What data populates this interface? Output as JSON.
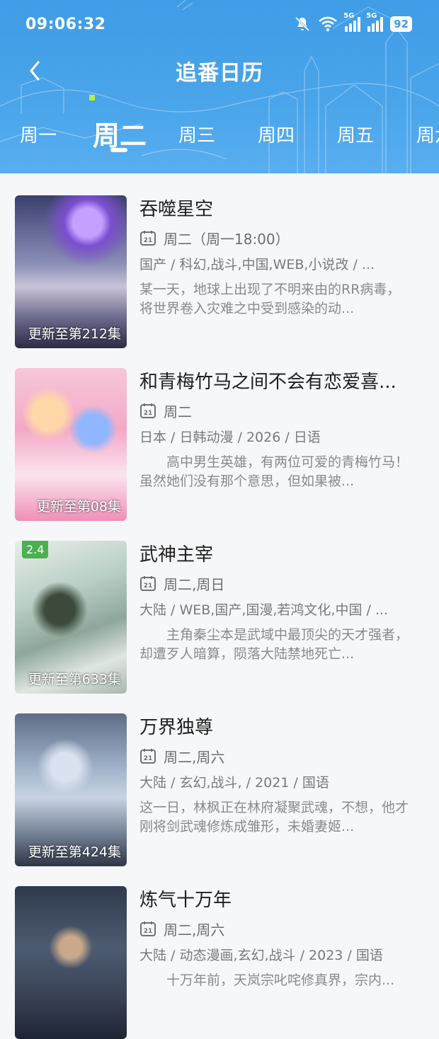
{
  "status_bar": {
    "time": "09:06:32",
    "battery": "92",
    "network1": "5G",
    "network2": "5G"
  },
  "header": {
    "title": "追番日历"
  },
  "tabs": [
    "周一",
    "周二",
    "周三",
    "周四",
    "周五",
    "周六"
  ],
  "active_tab": "周二",
  "colors": {
    "header": "#3f9ce6",
    "rating": "#4caf50",
    "background": "#f6f7f9"
  },
  "items": [
    {
      "name": "吞噬星空",
      "schedule": "周二（周一18:00）",
      "tags": "国产 / 科幻,战斗,中国,WEB,小说改 / ...",
      "desc": "某一天，地球上出现了不明来由的RR病毒，将世界卷入灾难之中受到感染的动...",
      "update": "更新至第212集"
    },
    {
      "name": "和青梅竹马之间不会有恋爱喜...",
      "schedule": "周二",
      "tags": "日本 / 日韩动漫 / 2026 / 日语",
      "desc": "　　高中男生英雄，有两位可爱的青梅竹马！虽然她们没有那个意思，但如果被...",
      "update": "更新至第08集"
    },
    {
      "name": "武神主宰",
      "schedule": "周二,周日",
      "tags": "大陆 / WEB,国产,国漫,若鸿文化,中国 / ...",
      "desc": "　　主角秦尘本是武域中最顶尖的天才强者，却遭歹人暗算，陨落大陆禁地死亡...",
      "update": "更新至第633集",
      "rating": "2.4"
    },
    {
      "name": "万界独尊",
      "schedule": "周二,周六",
      "tags": "大陆 / 玄幻,战斗, / 2021 / 国语",
      "desc": "这一日，林枫正在林府凝聚武魂，不想，他才刚将剑武魂修炼成雏形，未婚妻姬...",
      "update": "更新至第424集"
    },
    {
      "name": "炼气十万年",
      "schedule": "周二,周六",
      "tags": "大陆 / 动态漫画,玄幻,战斗 / 2023 / 国语",
      "desc": "　　十万年前，天岚宗叱咤修真界，宗内...",
      "update": ""
    }
  ]
}
